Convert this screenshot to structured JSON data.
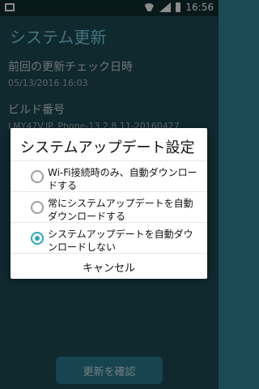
{
  "status_bar": {
    "time": "16:56"
  },
  "screen": {
    "title": "システム更新",
    "last_check": {
      "label": "前回の更新チェック日時",
      "value": "05/13/2016 16:03"
    },
    "build": {
      "label": "ビルド番号",
      "value": "LMY47V.JP_Phone-13.2.8.11-20160427"
    },
    "confirm_button": "更新を確認"
  },
  "dialog": {
    "title": "システムアップデート設定",
    "options": [
      {
        "label": "Wi-Fi接続時のみ、自動ダウンロードする",
        "selected": false
      },
      {
        "label": "常にシステムアップデートを自動ダウンロードする",
        "selected": false
      },
      {
        "label": "システムアップデートを自動ダウンロードしない",
        "selected": true
      }
    ],
    "cancel": "キャンセル"
  },
  "colors": {
    "accent": "#2aa6c6",
    "background": "#1c4b55"
  },
  "icons": {
    "status_left": "notification-icon",
    "wifi": "wifi-icon",
    "signal": "signal-icon",
    "battery": "battery-icon"
  }
}
